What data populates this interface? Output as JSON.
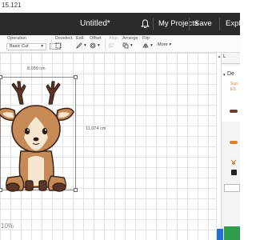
{
  "window": {
    "title_fragment": "15.121"
  },
  "header": {
    "doc_title": "Untitled*",
    "my_projects": "My Projects",
    "save": "Save",
    "explore": "Explo"
  },
  "toolbar": {
    "operation_label": "Operation",
    "operation_value": "Basic Cut",
    "deselect": "Deselect",
    "edit": "Edit",
    "offset": "Offset",
    "align": "Align",
    "arrange": "Arrange",
    "flip": "Flip",
    "more": "More"
  },
  "canvas": {
    "width_label": "8,039 cm",
    "height_label": "11,074 cm",
    "zoom": "10%"
  },
  "panel": {
    "header": "L",
    "row_prefix": "De",
    "row_line2": "Sup",
    "row_line3": "ES"
  },
  "colors": {
    "header_bg": "#2b2b2b",
    "accent_green": "#2e9c4a",
    "accent_orange": "#d9822b",
    "deer_brown": "#c58a55",
    "deer_dark": "#5a3626",
    "deer_cream": "#f7e6cf"
  }
}
